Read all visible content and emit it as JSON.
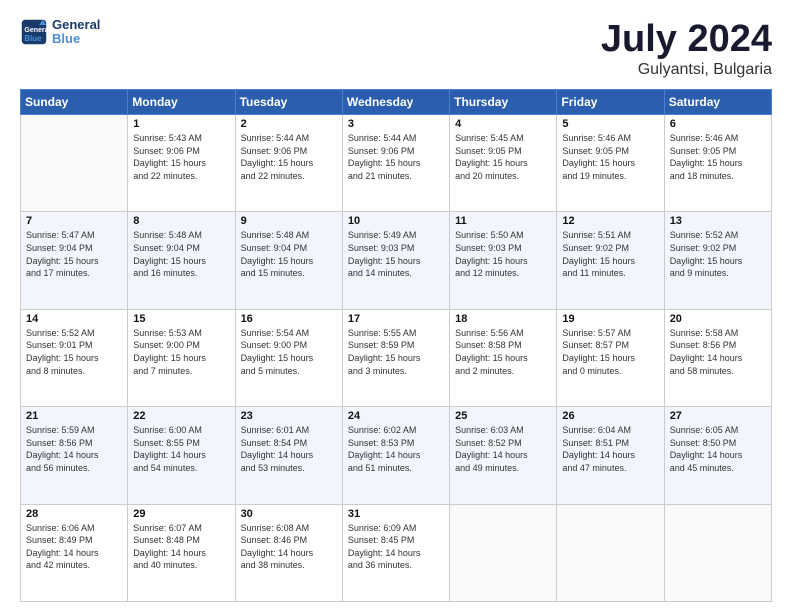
{
  "header": {
    "logo_line1": "General",
    "logo_line2": "Blue",
    "main_title": "July 2024",
    "subtitle": "Gulyantsi, Bulgaria"
  },
  "calendar": {
    "columns": [
      "Sunday",
      "Monday",
      "Tuesday",
      "Wednesday",
      "Thursday",
      "Friday",
      "Saturday"
    ],
    "weeks": [
      [
        {
          "day": "",
          "info": ""
        },
        {
          "day": "1",
          "info": "Sunrise: 5:43 AM\nSunset: 9:06 PM\nDaylight: 15 hours\nand 22 minutes."
        },
        {
          "day": "2",
          "info": "Sunrise: 5:44 AM\nSunset: 9:06 PM\nDaylight: 15 hours\nand 22 minutes."
        },
        {
          "day": "3",
          "info": "Sunrise: 5:44 AM\nSunset: 9:06 PM\nDaylight: 15 hours\nand 21 minutes."
        },
        {
          "day": "4",
          "info": "Sunrise: 5:45 AM\nSunset: 9:05 PM\nDaylight: 15 hours\nand 20 minutes."
        },
        {
          "day": "5",
          "info": "Sunrise: 5:46 AM\nSunset: 9:05 PM\nDaylight: 15 hours\nand 19 minutes."
        },
        {
          "day": "6",
          "info": "Sunrise: 5:46 AM\nSunset: 9:05 PM\nDaylight: 15 hours\nand 18 minutes."
        }
      ],
      [
        {
          "day": "7",
          "info": "Sunrise: 5:47 AM\nSunset: 9:04 PM\nDaylight: 15 hours\nand 17 minutes."
        },
        {
          "day": "8",
          "info": "Sunrise: 5:48 AM\nSunset: 9:04 PM\nDaylight: 15 hours\nand 16 minutes."
        },
        {
          "day": "9",
          "info": "Sunrise: 5:48 AM\nSunset: 9:04 PM\nDaylight: 15 hours\nand 15 minutes."
        },
        {
          "day": "10",
          "info": "Sunrise: 5:49 AM\nSunset: 9:03 PM\nDaylight: 15 hours\nand 14 minutes."
        },
        {
          "day": "11",
          "info": "Sunrise: 5:50 AM\nSunset: 9:03 PM\nDaylight: 15 hours\nand 12 minutes."
        },
        {
          "day": "12",
          "info": "Sunrise: 5:51 AM\nSunset: 9:02 PM\nDaylight: 15 hours\nand 11 minutes."
        },
        {
          "day": "13",
          "info": "Sunrise: 5:52 AM\nSunset: 9:02 PM\nDaylight: 15 hours\nand 9 minutes."
        }
      ],
      [
        {
          "day": "14",
          "info": "Sunrise: 5:52 AM\nSunset: 9:01 PM\nDaylight: 15 hours\nand 8 minutes."
        },
        {
          "day": "15",
          "info": "Sunrise: 5:53 AM\nSunset: 9:00 PM\nDaylight: 15 hours\nand 7 minutes."
        },
        {
          "day": "16",
          "info": "Sunrise: 5:54 AM\nSunset: 9:00 PM\nDaylight: 15 hours\nand 5 minutes."
        },
        {
          "day": "17",
          "info": "Sunrise: 5:55 AM\nSunset: 8:59 PM\nDaylight: 15 hours\nand 3 minutes."
        },
        {
          "day": "18",
          "info": "Sunrise: 5:56 AM\nSunset: 8:58 PM\nDaylight: 15 hours\nand 2 minutes."
        },
        {
          "day": "19",
          "info": "Sunrise: 5:57 AM\nSunset: 8:57 PM\nDaylight: 15 hours\nand 0 minutes."
        },
        {
          "day": "20",
          "info": "Sunrise: 5:58 AM\nSunset: 8:56 PM\nDaylight: 14 hours\nand 58 minutes."
        }
      ],
      [
        {
          "day": "21",
          "info": "Sunrise: 5:59 AM\nSunset: 8:56 PM\nDaylight: 14 hours\nand 56 minutes."
        },
        {
          "day": "22",
          "info": "Sunrise: 6:00 AM\nSunset: 8:55 PM\nDaylight: 14 hours\nand 54 minutes."
        },
        {
          "day": "23",
          "info": "Sunrise: 6:01 AM\nSunset: 8:54 PM\nDaylight: 14 hours\nand 53 minutes."
        },
        {
          "day": "24",
          "info": "Sunrise: 6:02 AM\nSunset: 8:53 PM\nDaylight: 14 hours\nand 51 minutes."
        },
        {
          "day": "25",
          "info": "Sunrise: 6:03 AM\nSunset: 8:52 PM\nDaylight: 14 hours\nand 49 minutes."
        },
        {
          "day": "26",
          "info": "Sunrise: 6:04 AM\nSunset: 8:51 PM\nDaylight: 14 hours\nand 47 minutes."
        },
        {
          "day": "27",
          "info": "Sunrise: 6:05 AM\nSunset: 8:50 PM\nDaylight: 14 hours\nand 45 minutes."
        }
      ],
      [
        {
          "day": "28",
          "info": "Sunrise: 6:06 AM\nSunset: 8:49 PM\nDaylight: 14 hours\nand 42 minutes."
        },
        {
          "day": "29",
          "info": "Sunrise: 6:07 AM\nSunset: 8:48 PM\nDaylight: 14 hours\nand 40 minutes."
        },
        {
          "day": "30",
          "info": "Sunrise: 6:08 AM\nSunset: 8:46 PM\nDaylight: 14 hours\nand 38 minutes."
        },
        {
          "day": "31",
          "info": "Sunrise: 6:09 AM\nSunset: 8:45 PM\nDaylight: 14 hours\nand 36 minutes."
        },
        {
          "day": "",
          "info": ""
        },
        {
          "day": "",
          "info": ""
        },
        {
          "day": "",
          "info": ""
        }
      ]
    ]
  }
}
